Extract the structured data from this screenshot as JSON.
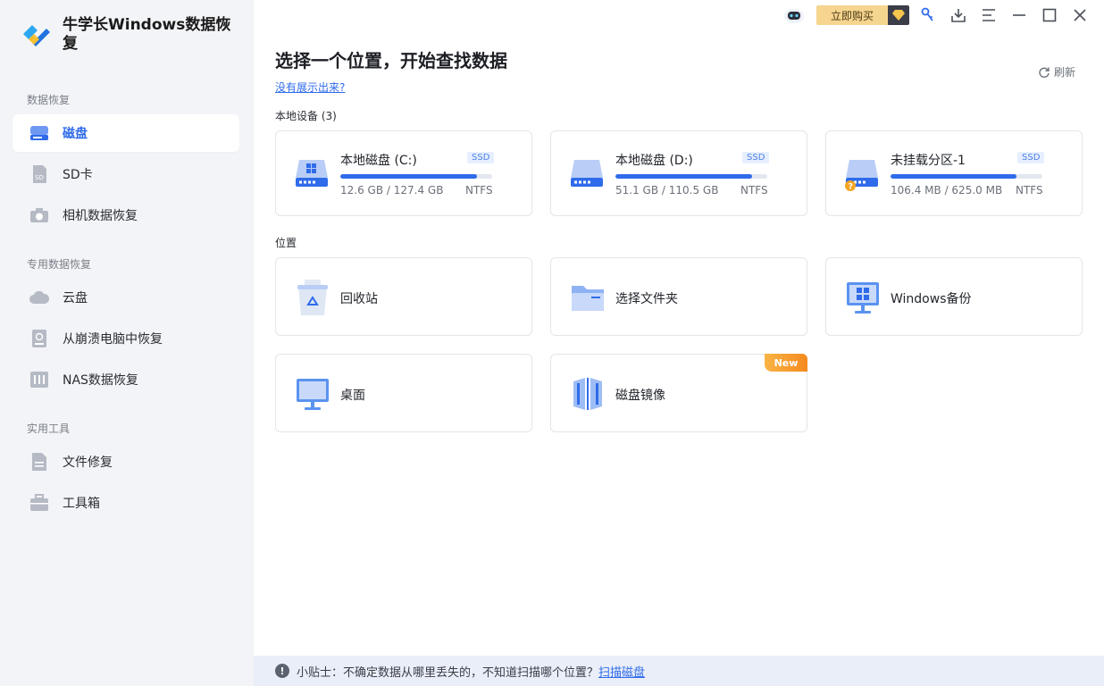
{
  "app": {
    "title": "牛学长Windows数据恢复"
  },
  "sidebar": {
    "groups": [
      {
        "title": "数据恢复",
        "items": [
          {
            "label": "磁盘",
            "icon": "disk-icon",
            "active": true
          },
          {
            "label": "SD卡",
            "icon": "sd-card-icon"
          },
          {
            "label": "相机数据恢复",
            "icon": "camera-icon"
          }
        ]
      },
      {
        "title": "专用数据恢复",
        "items": [
          {
            "label": "云盘",
            "icon": "cloud-icon"
          },
          {
            "label": "从崩溃电脑中恢复",
            "icon": "crashed-pc-icon"
          },
          {
            "label": "NAS数据恢复",
            "icon": "nas-icon"
          }
        ]
      },
      {
        "title": "实用工具",
        "items": [
          {
            "label": "文件修复",
            "icon": "file-repair-icon"
          },
          {
            "label": "工具箱",
            "icon": "toolbox-icon"
          }
        ]
      }
    ]
  },
  "topbar": {
    "buy_label": "立即购买"
  },
  "main": {
    "title": "选择一个位置，开始查找数据",
    "help_link": "没有展示出来?",
    "refresh_label": "刷新",
    "devices_label": "本地设备 (3)",
    "devices": [
      {
        "name": "本地磁盘 (C:)",
        "badge": "SSD",
        "size": "12.6 GB / 127.4 GB",
        "fs": "NTFS",
        "usage": 0.9
      },
      {
        "name": "本地磁盘 (D:)",
        "badge": "SSD",
        "size": "51.1 GB / 110.5 GB",
        "fs": "NTFS",
        "usage": 0.9
      },
      {
        "name": "未挂载分区-1",
        "badge": "SSD",
        "size": "106.4 MB / 625.0 MB",
        "fs": "NTFS",
        "usage": 0.83
      }
    ],
    "locations_label": "位置",
    "locations": [
      {
        "name": "回收站",
        "icon": "recycle-bin-icon"
      },
      {
        "name": "选择文件夹",
        "icon": "folder-icon"
      },
      {
        "name": "Windows备份",
        "icon": "windows-backup-icon"
      },
      {
        "name": "桌面",
        "icon": "desktop-icon"
      },
      {
        "name": "磁盘镜像",
        "icon": "disk-image-icon",
        "badge": "New"
      }
    ]
  },
  "tip": {
    "text": "小贴士：不确定数据从哪里丢失的，不知道扫描哪个位置？",
    "link": "扫描磁盘"
  },
  "colors": {
    "accent": "#2f6bea",
    "sidebar_bg": "#f3f4f7",
    "tip_bg": "#e9eef8",
    "new_badge": "#f58a1f"
  }
}
